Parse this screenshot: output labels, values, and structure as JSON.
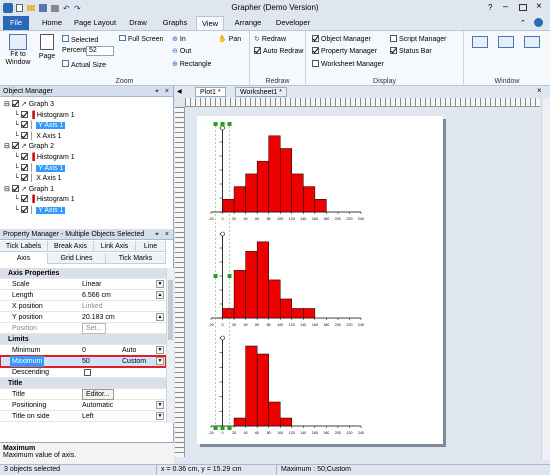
{
  "app_title": "Grapher (Demo Version)",
  "ribbon_tabs": [
    "File",
    "Home",
    "Page Layout",
    "Draw",
    "Graphs",
    "View",
    "Arrange",
    "Developer"
  ],
  "zoom_group": {
    "fit_label": "Fit to Window",
    "page_label": "Page",
    "selected_label": "Selected",
    "full_screen_label": "Full Screen",
    "percent_label": "Percent",
    "percent_value": "52",
    "actual_size_label": "Actual Size",
    "in_label": "In",
    "out_label": "Out",
    "rectangle_label": "Rectangle",
    "pan_label": "Pan",
    "group_label": "Zoom"
  },
  "redraw_group": {
    "redraw_label": "Redraw",
    "auto_redraw_label": "Auto Redraw",
    "group_label": "Redraw"
  },
  "display_group": {
    "object_manager_label": "Object Manager",
    "property_manager_label": "Property Manager",
    "worksheet_manager_label": "Worksheet Manager",
    "script_manager_label": "Script Manager",
    "status_bar_label": "Status Bar",
    "group_label": "Display"
  },
  "window_group": {
    "group_label": "Window"
  },
  "object_manager": {
    "title": "Object Manager",
    "items": [
      {
        "label": "Graph 3"
      },
      {
        "label": "Histogram 1"
      },
      {
        "label": "Y Axis 1"
      },
      {
        "label": "X Axis 1"
      },
      {
        "label": "Graph 2"
      },
      {
        "label": "Histogram 1"
      },
      {
        "label": "Y Axis 1"
      },
      {
        "label": "X Axis 1"
      },
      {
        "label": "Graph 1"
      },
      {
        "label": "Histogram 1"
      },
      {
        "label": "Y Axis 1"
      }
    ]
  },
  "property_manager": {
    "title": "Property Manager - Multiple Objects Selected",
    "tabs_row1": [
      "Tick Labels",
      "Break Axis",
      "Link Axis",
      "Line"
    ],
    "tabs_row2": [
      "Axis",
      "Grid Lines",
      "Tick Marks"
    ],
    "sections": {
      "axis_properties": "Axis Properties",
      "limits": "Limits",
      "title": "Title"
    },
    "rows": {
      "scale": {
        "k": "Scale",
        "v": "Linear"
      },
      "length": {
        "k": "Length",
        "v": "6.566 cm"
      },
      "xpos": {
        "k": "X position",
        "v": "Linked"
      },
      "ypos": {
        "k": "Y position",
        "v": "20.183 cm"
      },
      "position": {
        "k": "Position",
        "v": "Set..."
      },
      "minimum": {
        "k": "Minimum",
        "v": "0",
        "v2": "Auto"
      },
      "maximum": {
        "k": "Maximum",
        "v": "50",
        "v2": "Custom"
      },
      "descending": {
        "k": "Descending"
      },
      "title": {
        "k": "Title",
        "v": "Editor..."
      },
      "positioning": {
        "k": "Positioning",
        "v": "Automatic"
      },
      "title_on_side": {
        "k": "Title on side",
        "v": "Left"
      }
    }
  },
  "help": {
    "title": "Maximum",
    "text": "Maximum value of axis."
  },
  "status": {
    "left": "3 objects selected",
    "middle": "x = 0.36 cm, y = 15.29 cm",
    "right": "Maximum : 50;Custom"
  },
  "doc_tabs": [
    "Plot1 *",
    "Worksheet1 *"
  ],
  "chart_data": [
    {
      "type": "bar",
      "title": "",
      "categories": [
        "0-20",
        "20-40",
        "40-60",
        "60-80",
        "80-100",
        "100-120",
        "120-140",
        "140-160",
        "160-180",
        "180-200"
      ],
      "values": [
        1,
        2,
        3,
        4,
        6,
        5,
        3,
        2,
        1,
        0
      ],
      "xlim": [
        -20,
        240
      ],
      "xticks": [
        "-20",
        "0",
        "20",
        "40",
        "60",
        "80",
        "100",
        "120",
        "140",
        "160",
        "180",
        "200",
        "220",
        "240"
      ]
    },
    {
      "type": "bar",
      "title": "",
      "categories": [
        "0-20",
        "20-40",
        "40-60",
        "60-80",
        "80-100",
        "100-120",
        "120-140",
        "140-160",
        "160-180",
        "180-200"
      ],
      "values": [
        1,
        5,
        7,
        8,
        4,
        2,
        1,
        1,
        0,
        0
      ],
      "xlim": [
        -20,
        240
      ],
      "xticks": [
        "-20",
        "0",
        "20",
        "40",
        "60",
        "80",
        "100",
        "120",
        "140",
        "160",
        "180",
        "200",
        "220",
        "240"
      ]
    },
    {
      "type": "bar",
      "title": "",
      "categories": [
        "20-40",
        "40-60",
        "60-80",
        "80-100",
        "100-120"
      ],
      "values": [
        1,
        10,
        9,
        3,
        1
      ],
      "xlim": [
        -20,
        240
      ],
      "xticks": [
        "-20",
        "0",
        "20",
        "40",
        "60",
        "80",
        "100",
        "120",
        "140",
        "160",
        "180",
        "200",
        "220",
        "240"
      ]
    }
  ]
}
